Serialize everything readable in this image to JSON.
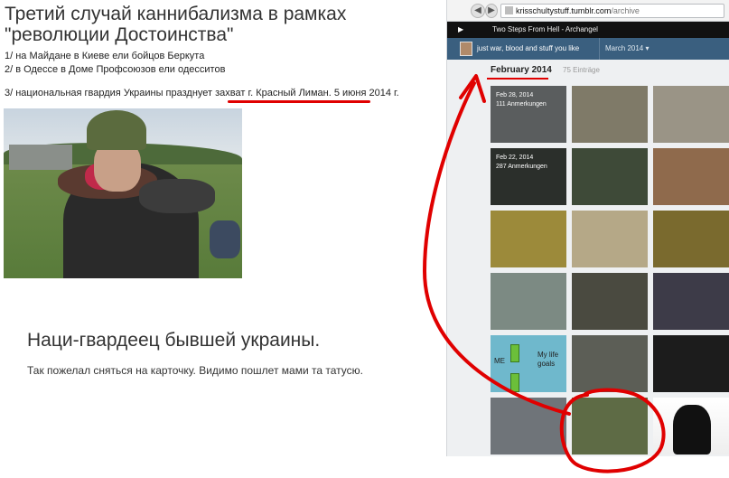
{
  "article": {
    "headline": "Третий случай каннибализма в рамках \"революции Достоинства\"",
    "facts": [
      "1/ на Майдане в Киеве ели бойцов Беркута",
      "2/ в Одессе в Доме Профсоюзов ели одесситов"
    ],
    "fact3_prefix": "3/ национальная гвардия Украины празднует захват ",
    "fact3_highlight": "г. Красный Лиман. 5 июня 2014 г.",
    "caption_title": "Наци-гвардеец бывшей украины.",
    "caption_sub": "Так пожелал сняться на карточку. Видимо пошлет мами та татусю."
  },
  "browser": {
    "url_prefix": "",
    "url_domain": "krisschultystuff.tumblr.com",
    "url_path": "/archive",
    "music_track": "Two Steps From Hell - Archangel",
    "blog_title": "just war, blood and stuff you like",
    "month_selector": "March 2014",
    "archive_month": "February 2014",
    "archive_count": "75 Einträge",
    "tiles": [
      {
        "date": "Feb 28, 2014",
        "notes": "111 Anmerkungen",
        "color": "#5a5d5e"
      },
      {
        "date": "",
        "notes": "",
        "color": "#7f7a68"
      },
      {
        "date": "",
        "notes": "",
        "color": "#9a9486"
      },
      {
        "date": "Feb 22, 2014",
        "notes": "287 Anmerkungen",
        "color": "#2b2f2b"
      },
      {
        "date": "",
        "notes": "",
        "color": "#3e4a38"
      },
      {
        "date": "",
        "notes": "",
        "color": "#8f6a4c"
      },
      {
        "date": "",
        "notes": "",
        "color": "#9c8a3a"
      },
      {
        "date": "",
        "notes": "",
        "color": "#b5a887"
      },
      {
        "date": "",
        "notes": "",
        "color": "#7a6a2e"
      },
      {
        "date": "",
        "notes": "",
        "color": "#7c8a83"
      },
      {
        "date": "",
        "notes": "",
        "color": "#4a4a40"
      },
      {
        "date": "",
        "notes": "",
        "color": "#3d3b48"
      },
      {
        "date": "",
        "notes": "",
        "color": "#6fb8cc"
      },
      {
        "date": "",
        "notes": "",
        "color": "#5c5e56"
      },
      {
        "date": "",
        "notes": "",
        "color": "#1c1c1c"
      },
      {
        "date": "",
        "notes": "",
        "color": "#6f7479"
      },
      {
        "date": "",
        "notes": "",
        "color": "#5e6b45"
      },
      {
        "date": "",
        "notes": "",
        "color": "#ffffff"
      }
    ],
    "tile_extra": {
      "flappy_text_1": "My life",
      "flappy_text_2": "goals",
      "flappy_side": "ME"
    }
  },
  "colors": {
    "annotation_red": "#e00000",
    "tumblr_blue": "#3a5f7f",
    "music_bar": "#111111"
  }
}
